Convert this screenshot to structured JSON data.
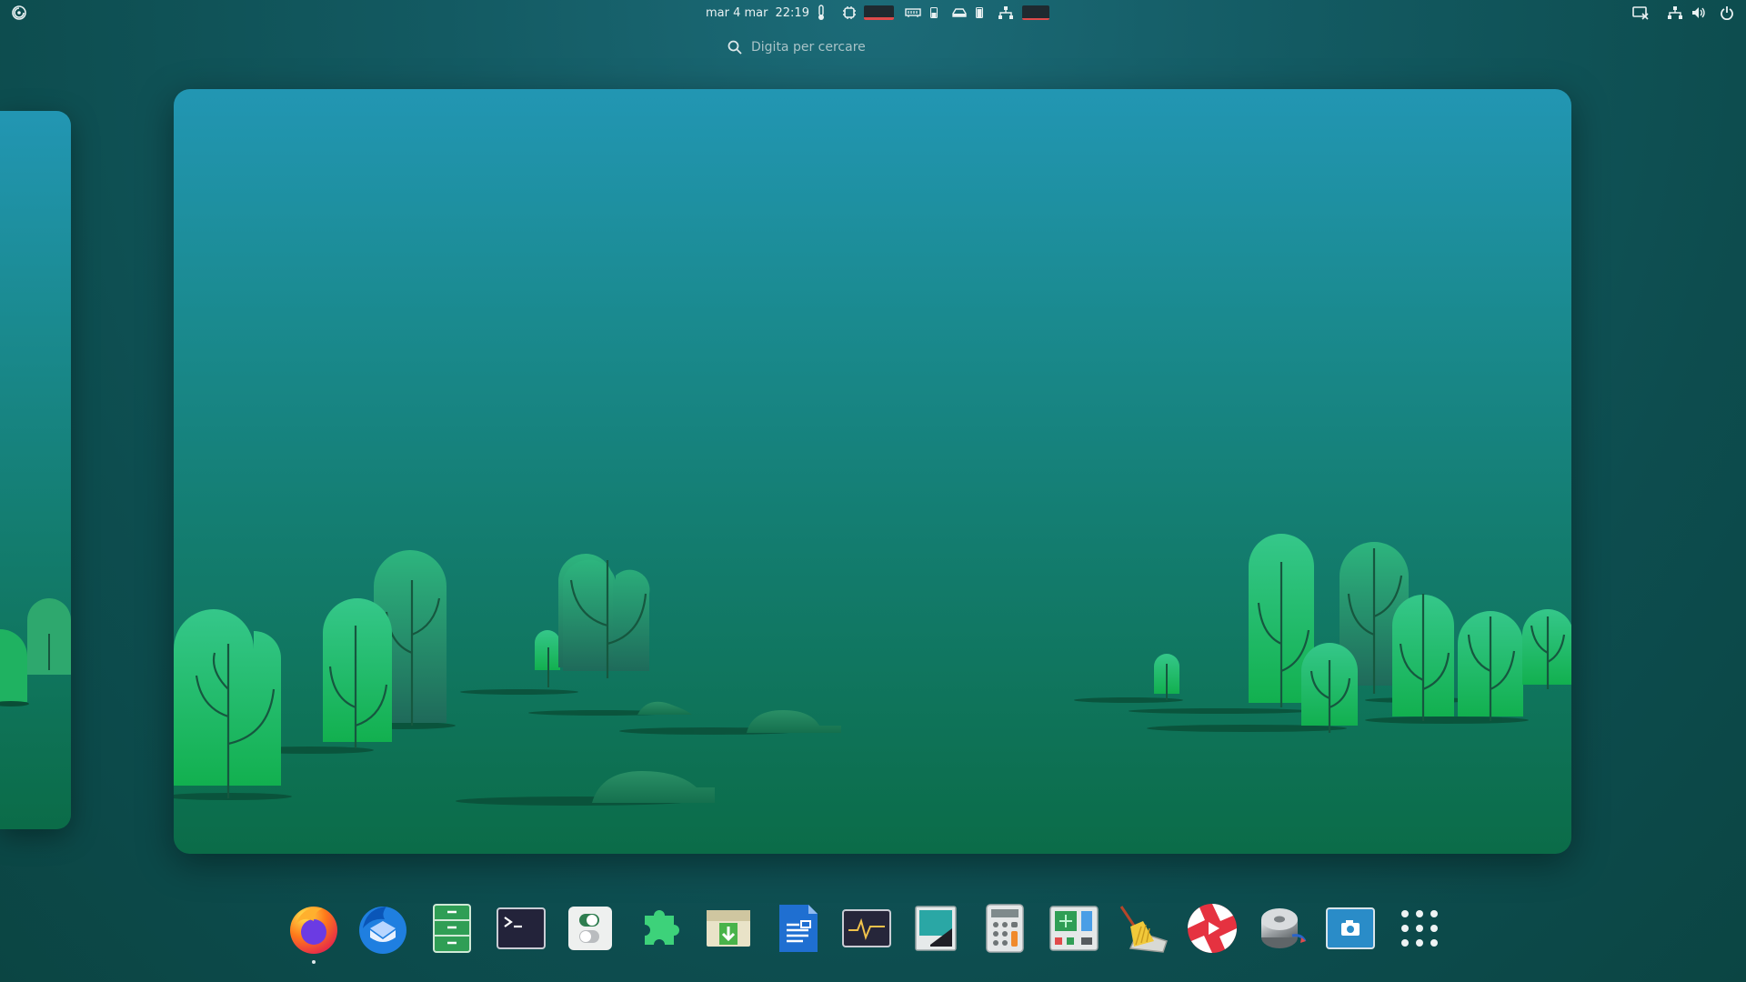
{
  "topbar": {
    "date": "mar 4 mar",
    "time": "22:19"
  },
  "search": {
    "placeholder": "Digita per cercare"
  },
  "dock": {
    "apps": [
      {
        "name": "firefox",
        "running": true
      },
      {
        "name": "thunderbird",
        "running": false
      },
      {
        "name": "files",
        "running": false
      },
      {
        "name": "terminal",
        "running": false
      },
      {
        "name": "settings",
        "running": false
      },
      {
        "name": "extensions",
        "running": false
      },
      {
        "name": "software-install",
        "running": false
      },
      {
        "name": "writer",
        "running": false
      },
      {
        "name": "system-monitor",
        "running": false
      },
      {
        "name": "image-viewer",
        "running": false
      },
      {
        "name": "calculator",
        "running": false
      },
      {
        "name": "control-center",
        "running": false
      },
      {
        "name": "cleaner",
        "running": false
      },
      {
        "name": "media-player",
        "running": false
      },
      {
        "name": "disk-utility",
        "running": false
      },
      {
        "name": "screenshot",
        "running": false
      },
      {
        "name": "show-apps",
        "running": false
      }
    ]
  },
  "colors": {
    "accent": "#1f8fb0",
    "tree_light": "#2fc98a",
    "tree_dark": "#1a7a5c",
    "ground": "#0b6c48"
  }
}
